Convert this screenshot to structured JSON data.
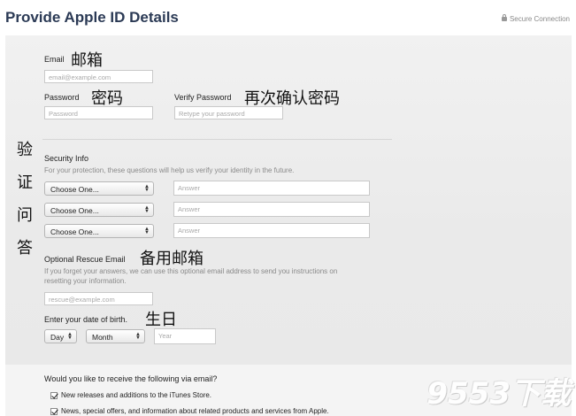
{
  "page_title": "Provide Apple ID Details",
  "secure_connection": "Secure Connection",
  "email": {
    "label": "Email",
    "placeholder": "email@example.com",
    "cn_note": "邮箱"
  },
  "password": {
    "label": "Password",
    "placeholder": "Password",
    "cn_note": "密码"
  },
  "verify_password": {
    "label": "Verify Password",
    "placeholder": "Retype your password",
    "cn_note": "再次确认密码"
  },
  "security": {
    "side_note": [
      "验",
      "证",
      "问",
      "答"
    ],
    "title": "Security Info",
    "description": "For your protection, these questions will help us verify your identity in the future.",
    "questions": [
      {
        "select": "Choose One...",
        "answer_placeholder": "Answer"
      },
      {
        "select": "Choose One...",
        "answer_placeholder": "Answer"
      },
      {
        "select": "Choose One...",
        "answer_placeholder": "Answer"
      }
    ]
  },
  "rescue": {
    "label": "Optional Rescue Email",
    "cn_note": "备用邮箱",
    "description_line1": "If you forget your answers, we can use this optional email address to send you instructions on",
    "description_line2": "resetting your information.",
    "placeholder": "rescue@example.com"
  },
  "birth": {
    "label": "Enter your date of birth.",
    "cn_note": "生日",
    "day": "Day",
    "month": "Month",
    "year_placeholder": "Year"
  },
  "email_prefs": {
    "question": "Would you like to receive the following via email?",
    "options": [
      {
        "label": "New releases and additions to the iTunes Store.",
        "checked": true
      },
      {
        "label": "News, special offers, and information about related products and services from Apple.",
        "checked": true
      }
    ]
  },
  "watermark": "9553下载"
}
